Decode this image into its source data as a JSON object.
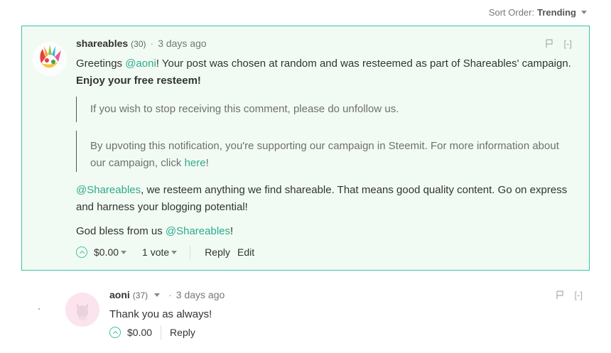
{
  "sort": {
    "label": "Sort Order:",
    "value": "Trending"
  },
  "main_comment": {
    "author": "shareables",
    "reputation": "(30)",
    "separator": "·",
    "time": "3 days ago",
    "flag_icon": "flag-icon",
    "collapse": "[-]",
    "body": {
      "greeting_pre": "Greetings ",
      "mention_user": "@aoni",
      "greeting_post": "! Your post was chosen at random and was resteemed as part of Shareables' campaign.",
      "bold_line": "Enjoy your free resteem!",
      "quote1": "If you wish to stop receiving this comment, please do unfollow us.",
      "quote2_pre": "By upvoting this notification, you're supporting our campaign in Steemit. For more information about our campaign, click ",
      "quote2_link": "here",
      "quote2_post": "!",
      "para3_mention": "@Shareables",
      "para3_text": ", we resteem anything we find shareable. That means good quality content. Go on express and harness your blogging potential!",
      "bless_pre": "God bless from us ",
      "bless_mention": "@Shareables",
      "bless_post": "!"
    },
    "footer": {
      "payout": "$0.00",
      "votes": "1 vote",
      "reply": "Reply",
      "edit": "Edit"
    }
  },
  "reply_comment": {
    "author": "aoni",
    "reputation": "(37)",
    "separator": "·",
    "time": "3 days ago",
    "collapse": "[-]",
    "body": "Thank you as always!",
    "footer": {
      "payout": "$0.00",
      "reply": "Reply"
    }
  },
  "colors": {
    "accent": "#3dc1a6",
    "highlight_bg": "#f1fbf3"
  }
}
